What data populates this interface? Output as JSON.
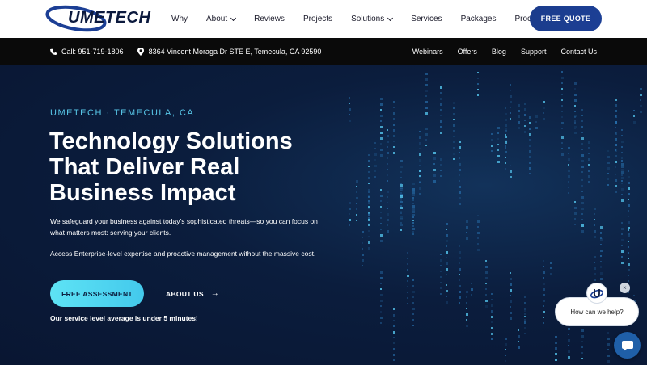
{
  "brand": {
    "logo_text": "UMETECH"
  },
  "nav": {
    "items": [
      {
        "label": "Why",
        "dropdown": false
      },
      {
        "label": "About",
        "dropdown": true
      },
      {
        "label": "Reviews",
        "dropdown": false
      },
      {
        "label": "Projects",
        "dropdown": false
      },
      {
        "label": "Solutions",
        "dropdown": true
      },
      {
        "label": "Services",
        "dropdown": false
      },
      {
        "label": "Packages",
        "dropdown": false
      },
      {
        "label": "Process",
        "dropdown": false
      }
    ],
    "cta_label": "FREE QUOTE"
  },
  "topbar": {
    "phone": "Call: 951-719-1806",
    "address": "8364 Vincent Moraga Dr STE E, Temecula, CA 92590",
    "links": [
      "Webinars",
      "Offers",
      "Blog",
      "Support",
      "Contact Us"
    ]
  },
  "hero": {
    "eyebrow": "UMETECH · TEMECULA, CA",
    "headline_line1": "Technology Solutions",
    "headline_line2": "That Deliver Real",
    "headline_line3": "Business Impact",
    "paragraph1": "We safeguard your business against today’s sophisticated threats—so you can focus on what matters most: serving your clients.",
    "paragraph2": "Access Enterprise-level expertise and proactive management without the massive cost.",
    "primary_cta": "FREE ASSESSMENT",
    "secondary_cta": "ABOUT US",
    "secondary_arrow": "→",
    "sla_text": "Our service level average is under 5 minutes!"
  },
  "chat": {
    "prompt": "How can we help?",
    "close_glyph": "×"
  },
  "colors": {
    "primary": "#1c3f95",
    "accent": "#43c9ec",
    "hero_bg": "#0b1d3d"
  }
}
